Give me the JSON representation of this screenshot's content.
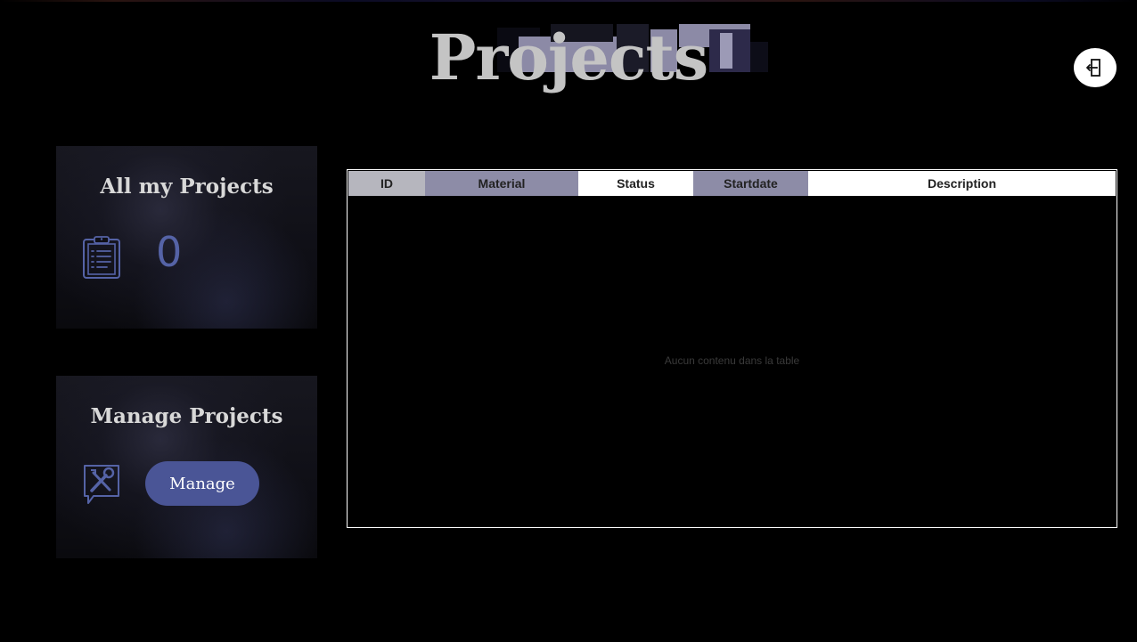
{
  "header": {
    "title": "Projects",
    "logout_icon": "logout-door-icon"
  },
  "cards": {
    "projects": {
      "title": "All my Projects",
      "icon": "clipboard-list-icon",
      "count": "0"
    },
    "manage": {
      "title": "Manage Projects",
      "icon": "tools-icon",
      "button_label": "Manage"
    }
  },
  "table": {
    "columns": [
      "ID",
      "Material",
      "Status",
      "Startdate",
      "Description"
    ],
    "rows": [],
    "empty_message": "Aucun contenu dans la table"
  },
  "colors": {
    "accent": "#4a5596",
    "counter": "#5563a6",
    "header_grey": "#b6b6be",
    "header_lavender": "#8d8ca7"
  }
}
